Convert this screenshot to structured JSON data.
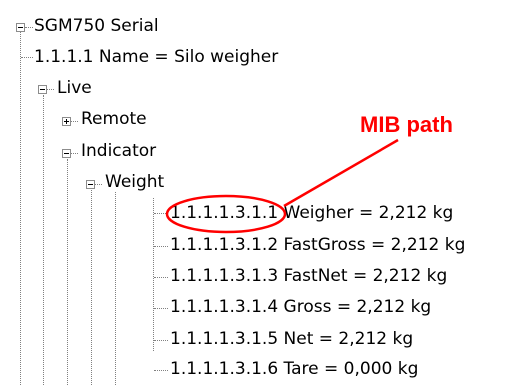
{
  "tree": {
    "root": {
      "label": "SGM750 Serial"
    },
    "name_node": {
      "label": "1.1.1.1 Name = Silo weigher"
    },
    "live": {
      "label": "Live"
    },
    "remote": {
      "label": "Remote"
    },
    "indicator": {
      "label": "Indicator"
    },
    "weight": {
      "label": "Weight"
    },
    "weight_items": [
      {
        "label": "1.1.1.1.3.1.1 Weigher = 2,212 kg"
      },
      {
        "label": "1.1.1.1.3.1.2 FastGross = 2,212 kg"
      },
      {
        "label": "1.1.1.1.3.1.3 FastNet = 2,212 kg"
      },
      {
        "label": "1.1.1.1.3.1.4 Gross = 2,212 kg"
      },
      {
        "label": "1.1.1.1.3.1.5 Net = 2,212 kg"
      },
      {
        "label": "1.1.1.1.3.1.6 Tare = 0,000 kg"
      }
    ]
  },
  "annotation": {
    "text": "MIB path",
    "color": "#ff0000"
  }
}
